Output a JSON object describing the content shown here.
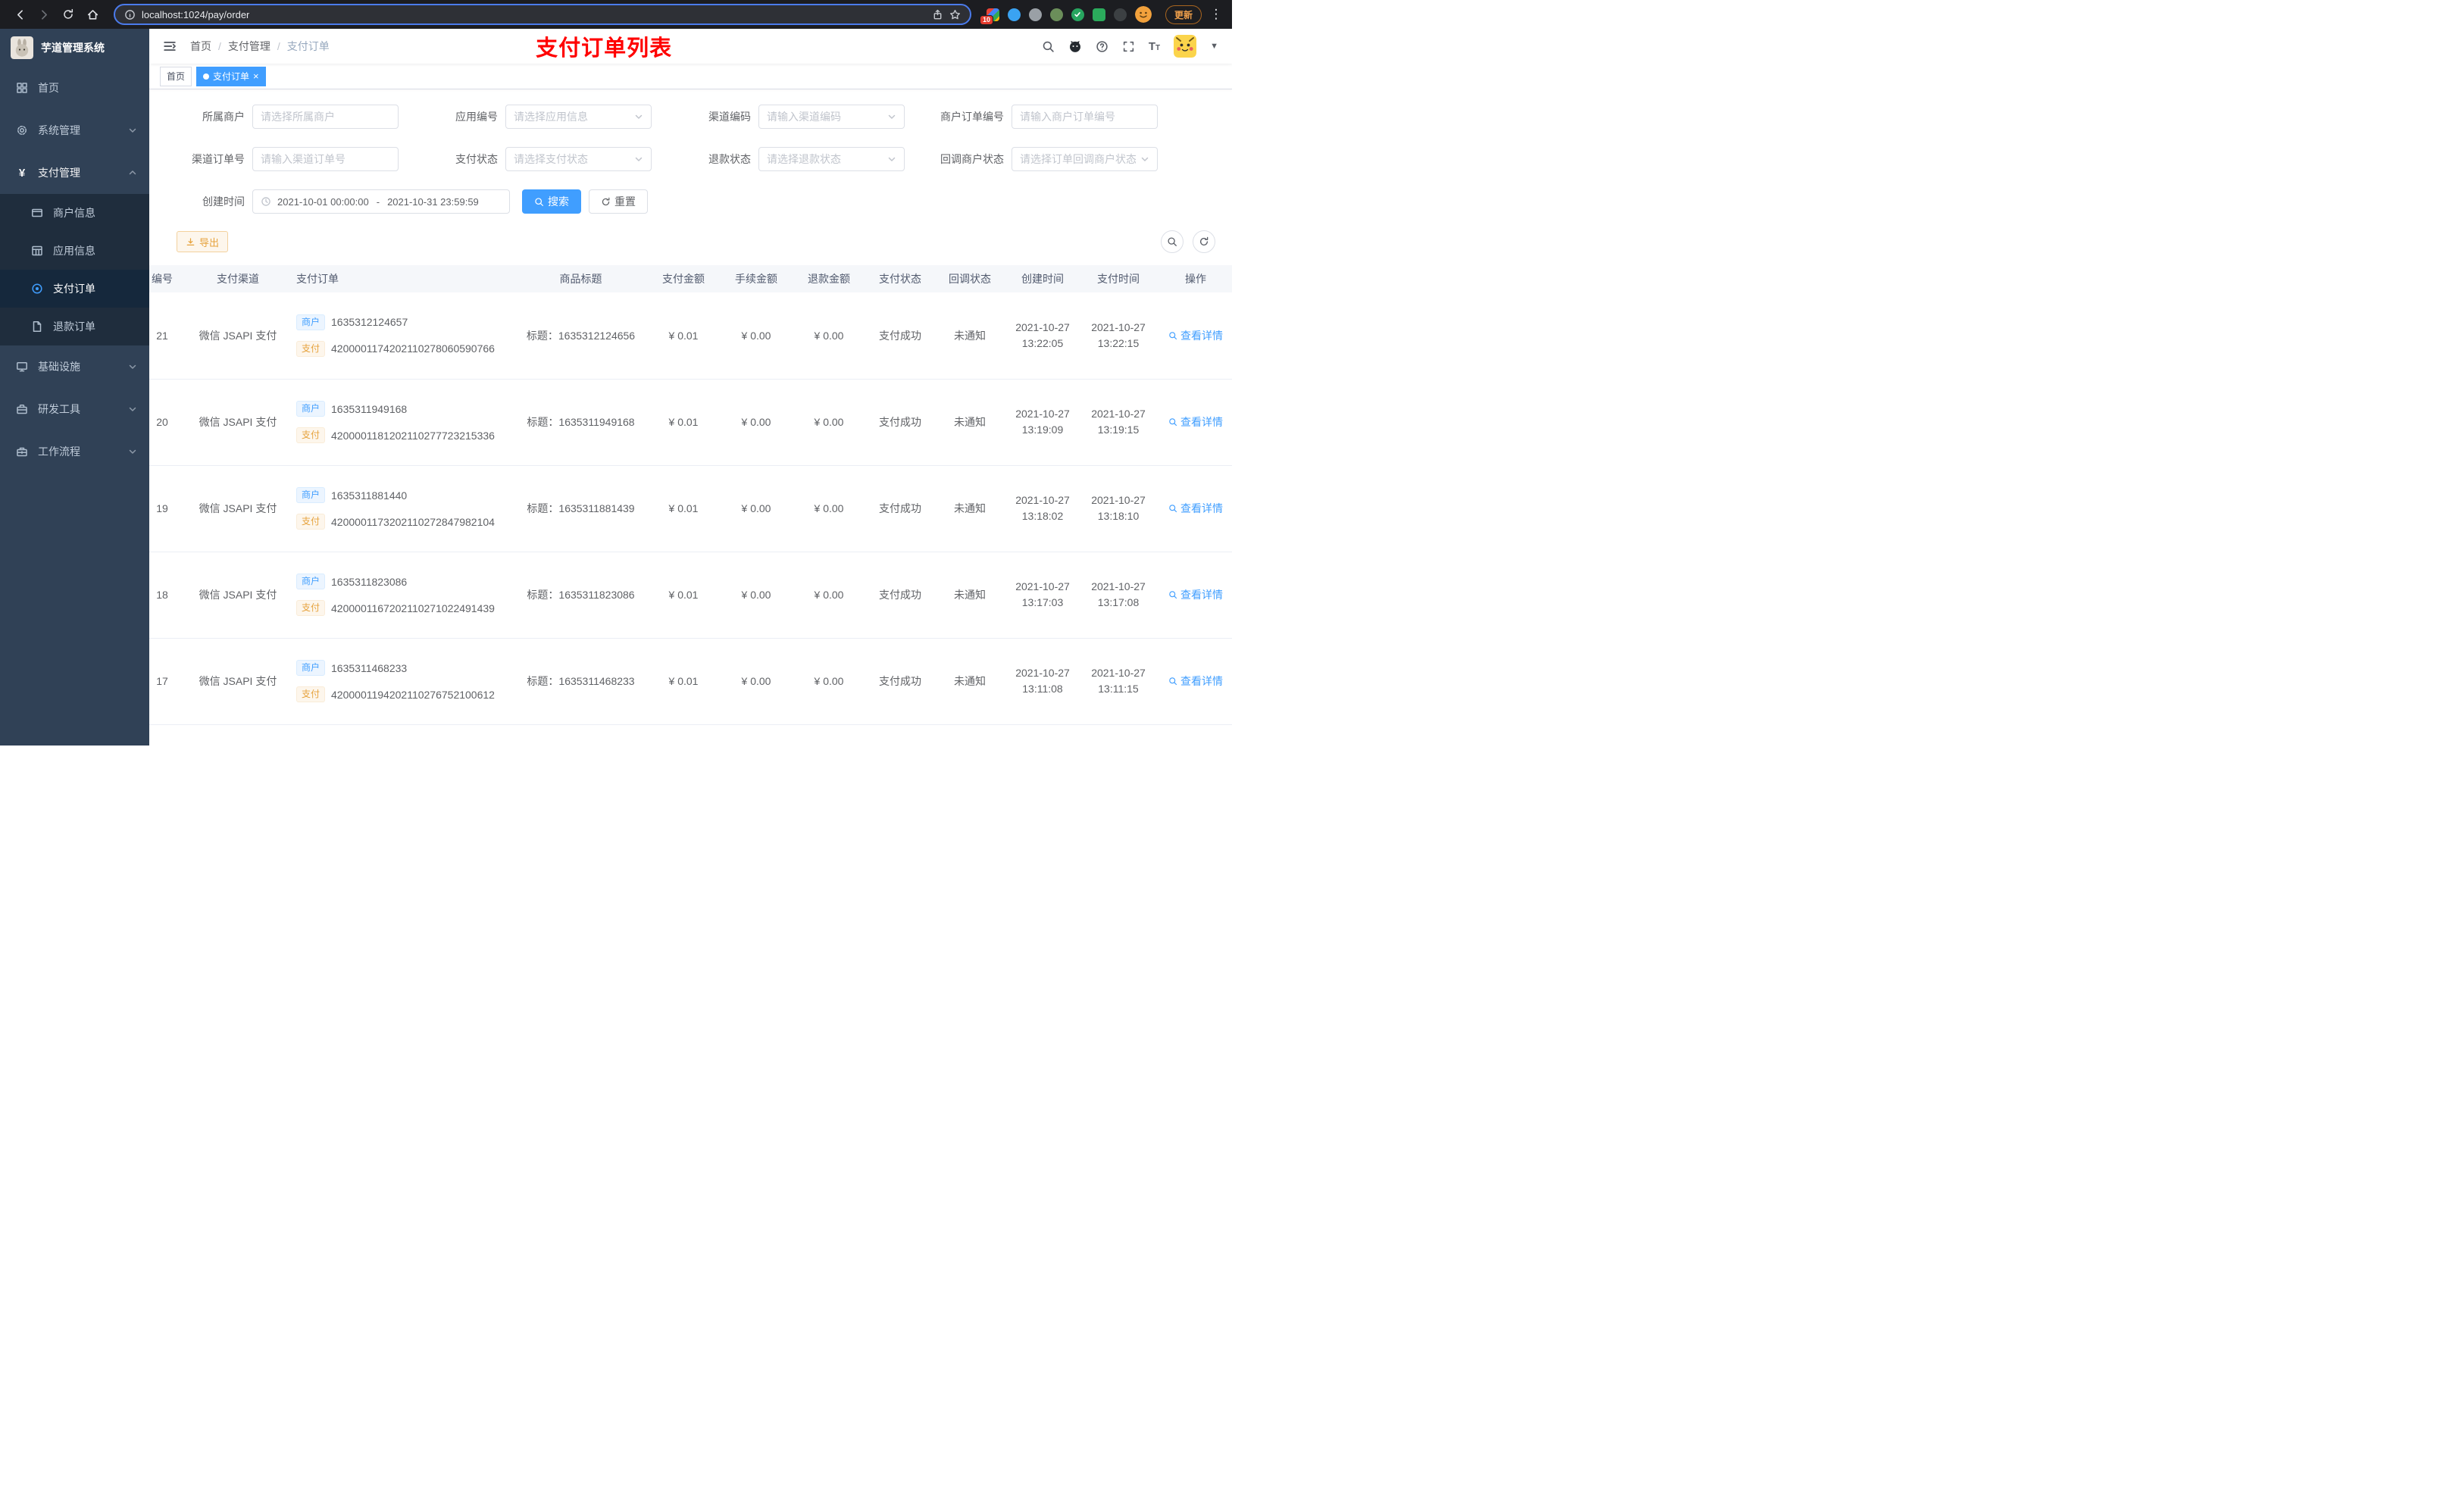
{
  "colors": {
    "accent_blue": "#409eff",
    "warning_orange": "#e6a23c",
    "banner_red": "#ff0000",
    "sidebar_bg": "#304156",
    "submenu_bg": "#1f2d3d",
    "url_focus_ring": "#4b7bec"
  },
  "icons": {
    "close": "×",
    "kebab": "⋮",
    "caret_down": "▼",
    "yen": "¥",
    "font_size_large": "T",
    "font_size_small": "T"
  },
  "browser": {
    "url": "localhost:1024/pay/order",
    "update_button": "更新",
    "extension_badge": "10"
  },
  "sidebar": {
    "app_title": "芋道管理系统",
    "items": [
      {
        "label": "首页"
      },
      {
        "label": "系统管理"
      },
      {
        "label": "支付管理"
      },
      {
        "label": "基础设施"
      },
      {
        "label": "研发工具"
      },
      {
        "label": "工作流程"
      }
    ],
    "pay_submenu": [
      {
        "label": "商户信息"
      },
      {
        "label": "应用信息"
      },
      {
        "label": "支付订单"
      },
      {
        "label": "退款订单"
      }
    ]
  },
  "header": {
    "breadcrumb": [
      {
        "label": "首页"
      },
      {
        "label": "支付管理"
      },
      {
        "label": "支付订单"
      }
    ],
    "separator": "/",
    "banner": "支付订单列表"
  },
  "tabs": [
    {
      "label": "首页"
    },
    {
      "label": "支付订单"
    }
  ],
  "filters": {
    "merchant": {
      "label": "所属商户",
      "placeholder": "请选择所属商户"
    },
    "app": {
      "label": "应用编号",
      "placeholder": "请选择应用信息"
    },
    "channel_code": {
      "label": "渠道编码",
      "placeholder": "请输入渠道编码"
    },
    "merchant_order_no": {
      "label": "商户订单编号",
      "placeholder": "请输入商户订单编号"
    },
    "channel_order_no": {
      "label": "渠道订单号",
      "placeholder": "请输入渠道订单号"
    },
    "pay_status": {
      "label": "支付状态",
      "placeholder": "请选择支付状态"
    },
    "refund_status": {
      "label": "退款状态",
      "placeholder": "请选择退款状态"
    },
    "callback_status": {
      "label": "回调商户状态",
      "placeholder": "请选择订单回调商户状态"
    },
    "create_time": {
      "label": "创建时间",
      "start": "2021-10-01 00:00:00",
      "separator": "-",
      "end": "2021-10-31 23:59:59"
    },
    "search_button": "搜索",
    "reset_button": "重置"
  },
  "toolbar": {
    "export_button": "导出"
  },
  "table": {
    "headers": [
      "编号",
      "支付渠道",
      "支付订单",
      "商品标题",
      "支付金额",
      "手续金额",
      "退款金额",
      "支付状态",
      "回调状态",
      "创建时间",
      "支付时间",
      "操作"
    ],
    "badges": {
      "merchant": "商户",
      "pay": "支付"
    },
    "action_label": "查看详情",
    "rows": [
      {
        "id": "21",
        "channel": "微信 JSAPI 支付",
        "merchant_no": "1635312124657",
        "channel_no": "4200001174202110278060590766",
        "title": "标题：1635312124656",
        "amount": "¥ 0.01",
        "fee": "¥ 0.00",
        "refund": "¥ 0.00",
        "status": "支付成功",
        "notify": "未通知",
        "create_date": "2021-10-27",
        "create_time": "13:22:05",
        "pay_date": "2021-10-27",
        "pay_time": "13:22:15"
      },
      {
        "id": "20",
        "channel": "微信 JSAPI 支付",
        "merchant_no": "1635311949168",
        "channel_no": "4200001181202110277723215336",
        "title": "标题：1635311949168",
        "amount": "¥ 0.01",
        "fee": "¥ 0.00",
        "refund": "¥ 0.00",
        "status": "支付成功",
        "notify": "未通知",
        "create_date": "2021-10-27",
        "create_time": "13:19:09",
        "pay_date": "2021-10-27",
        "pay_time": "13:19:15"
      },
      {
        "id": "19",
        "channel": "微信 JSAPI 支付",
        "merchant_no": "1635311881440",
        "channel_no": "4200001173202110272847982104",
        "title": "标题：1635311881439",
        "amount": "¥ 0.01",
        "fee": "¥ 0.00",
        "refund": "¥ 0.00",
        "status": "支付成功",
        "notify": "未通知",
        "create_date": "2021-10-27",
        "create_time": "13:18:02",
        "pay_date": "2021-10-27",
        "pay_time": "13:18:10"
      },
      {
        "id": "18",
        "channel": "微信 JSAPI 支付",
        "merchant_no": "1635311823086",
        "channel_no": "4200001167202110271022491439",
        "title": "标题：1635311823086",
        "amount": "¥ 0.01",
        "fee": "¥ 0.00",
        "refund": "¥ 0.00",
        "status": "支付成功",
        "notify": "未通知",
        "create_date": "2021-10-27",
        "create_time": "13:17:03",
        "pay_date": "2021-10-27",
        "pay_time": "13:17:08"
      },
      {
        "id": "17",
        "channel": "微信 JSAPI 支付",
        "merchant_no": "1635311468233",
        "channel_no": "4200001194202110276752100612",
        "title": "标题：1635311468233",
        "amount": "¥ 0.01",
        "fee": "¥ 0.00",
        "refund": "¥ 0.00",
        "status": "支付成功",
        "notify": "未通知",
        "create_date": "2021-10-27",
        "create_time": "13:11:08",
        "pay_date": "2021-10-27",
        "pay_time": "13:11:15"
      },
      {
        "id": "",
        "channel": "",
        "merchant_no": "",
        "channel_no": "",
        "title": "",
        "amount": "",
        "fee": "",
        "refund": "",
        "status": "",
        "notify": "",
        "create_date": "",
        "create_time": "",
        "pay_date": "",
        "pay_time": ""
      }
    ]
  }
}
